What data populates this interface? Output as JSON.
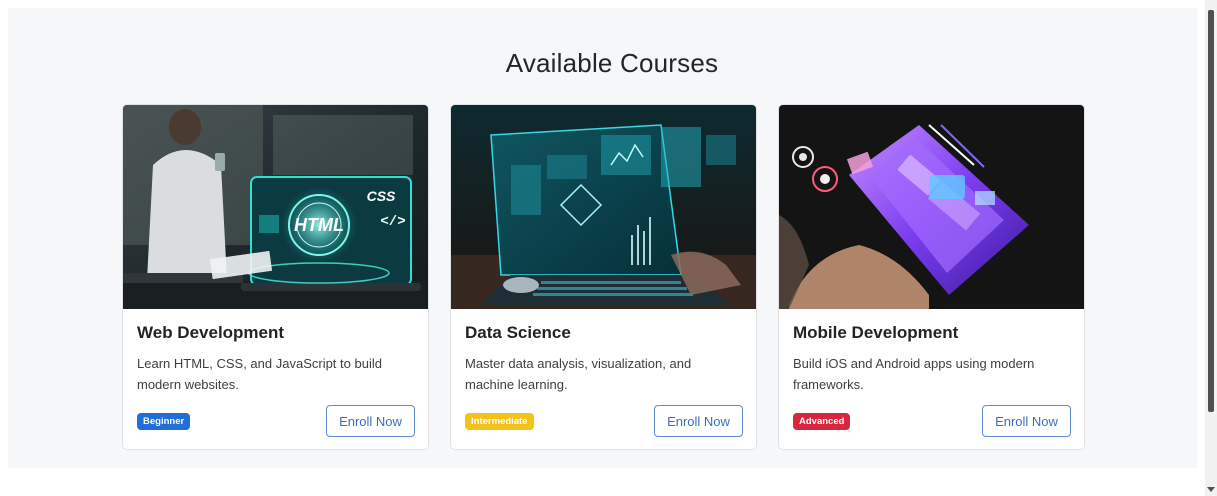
{
  "page": {
    "heading": "Available Courses"
  },
  "courses": [
    {
      "title": "Web Development",
      "description": "Learn HTML, CSS, and JavaScript to build modern websites.",
      "level": "Beginner",
      "level_color": "#1f6fd6",
      "button_label": "Enroll Now",
      "image_label_main": "HTML",
      "image_label_side": "CSS"
    },
    {
      "title": "Data Science",
      "description": "Master data analysis, visualization, and machine learning.",
      "level": "Intermediate",
      "level_color": "#f5c21b",
      "button_label": "Enroll Now"
    },
    {
      "title": "Mobile Development",
      "description": "Build iOS and Android apps using modern frameworks.",
      "level": "Advanced",
      "level_color": "#d7263d",
      "button_label": "Enroll Now"
    }
  ],
  "colors": {
    "page_background": "#f6f7f9",
    "button_border": "#5b8ccf",
    "button_text": "#3c6fb9"
  }
}
